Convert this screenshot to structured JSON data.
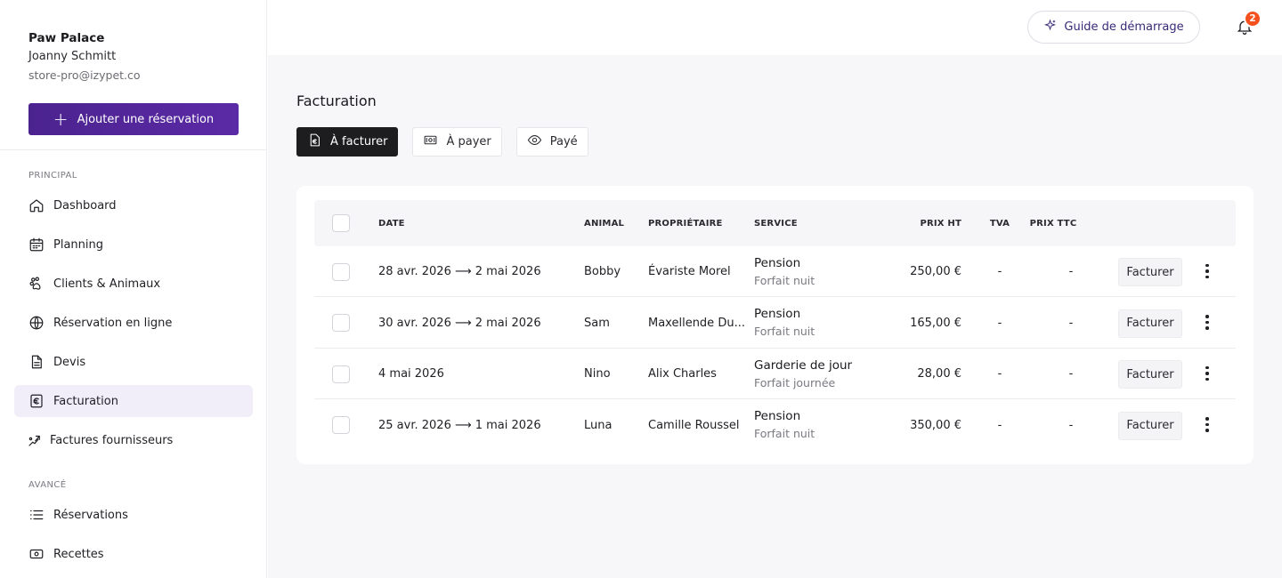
{
  "brand": {
    "name": "Paw Palace",
    "user": "Joanny Schmitt",
    "email": "store-pro@izypet.co"
  },
  "sidebar": {
    "add_button": "Ajouter une réservation",
    "section_principal": "PRINCIPAL",
    "section_avance": "AVANCÉ",
    "items": [
      {
        "label": "Dashboard",
        "icon": "home-icon"
      },
      {
        "label": "Planning",
        "icon": "calendar-icon"
      },
      {
        "label": "Clients & Animaux",
        "icon": "paw-icon"
      },
      {
        "label": "Réservation en ligne",
        "icon": "globe-icon"
      },
      {
        "label": "Devis",
        "icon": "document-icon"
      },
      {
        "label": "Facturation",
        "icon": "euro-icon",
        "active": true
      },
      {
        "label": "Factures fournisseurs",
        "icon": "supplier-icon"
      }
    ],
    "advanced_items": [
      {
        "label": "Réservations",
        "icon": "list-icon"
      },
      {
        "label": "Recettes",
        "icon": "money-icon"
      }
    ]
  },
  "topbar": {
    "guide_label": "Guide de démarrage",
    "notification_count": "2"
  },
  "page": {
    "title": "Facturation",
    "tabs": [
      {
        "label": "À facturer",
        "active": true,
        "icon": "euro-document-icon"
      },
      {
        "label": "À payer",
        "icon": "cash-icon"
      },
      {
        "label": "Payé",
        "icon": "eye-icon"
      }
    ]
  },
  "table": {
    "headers": {
      "date": "DATE",
      "animal": "ANIMAL",
      "owner": "PROPRIÉTAIRE",
      "service": "SERVICE",
      "price_ht": "PRIX HT",
      "tva": "TVA",
      "price_ttc": "PRIX TTC"
    },
    "action_label": "Facturer",
    "rows": [
      {
        "date": "28 avr. 2026 ⟶ 2 mai 2026",
        "animal": "Bobby",
        "owner": "Évariste Morel",
        "service": "Pension",
        "package": "Forfait nuit",
        "price_ht": "250,00 €",
        "tva": "-",
        "price_ttc": "-"
      },
      {
        "date": "30 avr. 2026 ⟶ 2 mai 2026",
        "animal": "Sam",
        "owner": "Maxellende Du...",
        "service": "Pension",
        "package": "Forfait nuit",
        "price_ht": "165,00 €",
        "tva": "-",
        "price_ttc": "-"
      },
      {
        "date": "4 mai 2026",
        "animal": "Nino",
        "owner": "Alix Charles",
        "service": "Garderie de jour",
        "package": "Forfait journée",
        "price_ht": "28,00 €",
        "tva": "-",
        "price_ttc": "-"
      },
      {
        "date": "25 avr. 2026 ⟶ 1 mai 2026",
        "animal": "Luna",
        "owner": "Camille Roussel",
        "service": "Pension",
        "package": "Forfait nuit",
        "price_ht": "350,00 €",
        "tva": "-",
        "price_ttc": "-"
      }
    ]
  }
}
